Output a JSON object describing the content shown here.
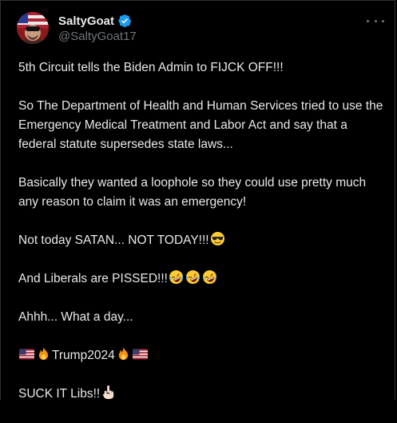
{
  "post": {
    "author": {
      "display_name": "SaltyGoat",
      "handle": "@SaltyGoat17",
      "verified": true,
      "avatar_icon": "avatar-flag-icon"
    },
    "more_icon": "more-dots-icon",
    "paragraphs": [
      {
        "text": "5th Circuit tells the Biden Admin to FIJCK OFF!!!"
      },
      {
        "text": "So The Department of Health and Human Services tried to use the Emergency Medical Treatment and Labor Act and say that a federal statute supersedes state laws..."
      },
      {
        "text": "Basically they wanted a loophole so they could use pretty much any reason to claim it was an emergency!"
      },
      {
        "text": "Not today SATAN... NOT TODAY!!!",
        "emoji_after": [
          "sunglasses-face"
        ]
      },
      {
        "text": "And Liberals are PISSED!!!",
        "emoji_after": [
          "rofl-face",
          "rofl-face",
          "rofl-face"
        ]
      },
      {
        "text": "Ahhh... What a day..."
      },
      {
        "emoji_before": [
          "us-flag",
          "fire"
        ],
        "text": "Trump2024",
        "emoji_after": [
          "fire",
          "us-flag"
        ]
      },
      {
        "text": "SUCK IT Libs!!",
        "emoji_after": [
          "middle-finger"
        ]
      }
    ]
  },
  "colors": {
    "background": "#000000",
    "text": "#e7e9ea",
    "muted": "#71767b",
    "verified_blue": "#1d9bf0",
    "border": "#2f3336"
  }
}
